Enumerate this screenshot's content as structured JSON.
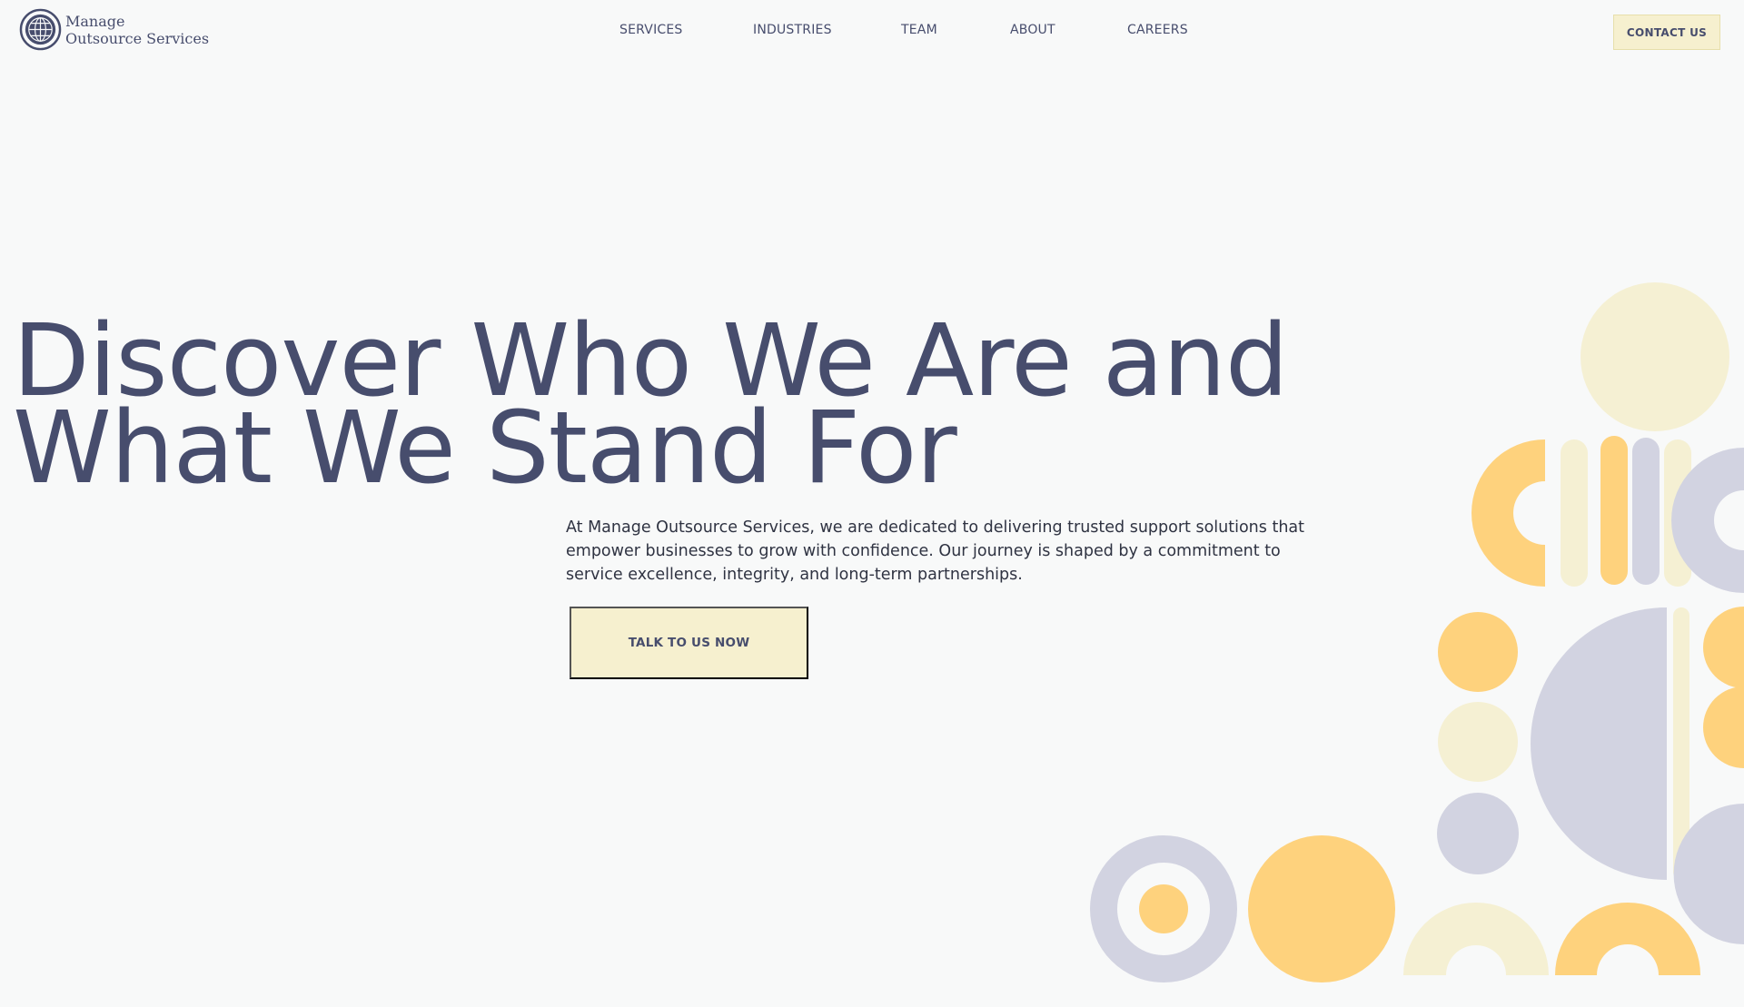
{
  "brand": {
    "name_line1": "Manage",
    "name_line2": "Outsource Services"
  },
  "nav": {
    "items": [
      "SERVICES",
      "INDUSTRIES",
      "TEAM",
      "ABOUT",
      "CAREERS"
    ],
    "contact_label": "CONTACT US"
  },
  "hero": {
    "title_line1": "Discover Who We Are and",
    "title_line2": "What We Stand For",
    "description": "At Manage Outsource Services, we are dedicated to delivering trusted support solutions that empower businesses to grow with confidence. Our journey is shaped by a commitment to service excellence, integrity, and long-term partnerships.",
    "cta_label": "TALK TO US NOW"
  },
  "colors": {
    "background": "#f8f9f9",
    "primary_text": "#474d6d",
    "button_bg": "#f6f0cf",
    "deco_yellow": "#fed27d",
    "deco_pale": "#f5f0d3",
    "deco_lavender": "#d2d3e1"
  },
  "icons": {
    "logo": "globe-icon"
  }
}
